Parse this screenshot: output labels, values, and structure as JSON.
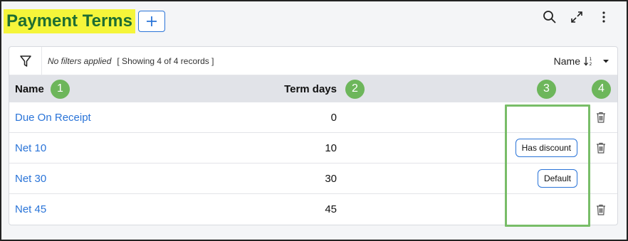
{
  "page": {
    "title": "Payment Terms",
    "add_icon": "plus-icon"
  },
  "top_actions": [
    {
      "icon": "search-icon"
    },
    {
      "icon": "expand-icon"
    },
    {
      "icon": "more-vertical-icon"
    }
  ],
  "toolbar": {
    "filter_icon": "filter-icon",
    "filter_status": "No filters applied",
    "showing": "[ Showing 4 of 4 records ]",
    "sort_label": "Name",
    "sort_icon": "sort-ascending-icon",
    "sort_dropdown_icon": "caret-down-icon"
  },
  "table": {
    "columns": {
      "name": "Name",
      "term_days": "Term days"
    },
    "callouts": [
      "1",
      "2",
      "3",
      "4"
    ],
    "rows": [
      {
        "name": "Due On Receipt",
        "term_days": "0",
        "tag": "",
        "deletable": true
      },
      {
        "name": "Net 10",
        "term_days": "10",
        "tag": "Has discount",
        "deletable": true
      },
      {
        "name": "Net 30",
        "term_days": "30",
        "tag": "Default",
        "deletable": false
      },
      {
        "name": "Net 45",
        "term_days": "45",
        "tag": "",
        "deletable": true
      }
    ]
  },
  "colors": {
    "title_highlight": "#f5f53a",
    "title_text": "#1e6e32",
    "link": "#2a74d8",
    "callout": "#6db65b",
    "highlight_box": "#78bd68"
  }
}
